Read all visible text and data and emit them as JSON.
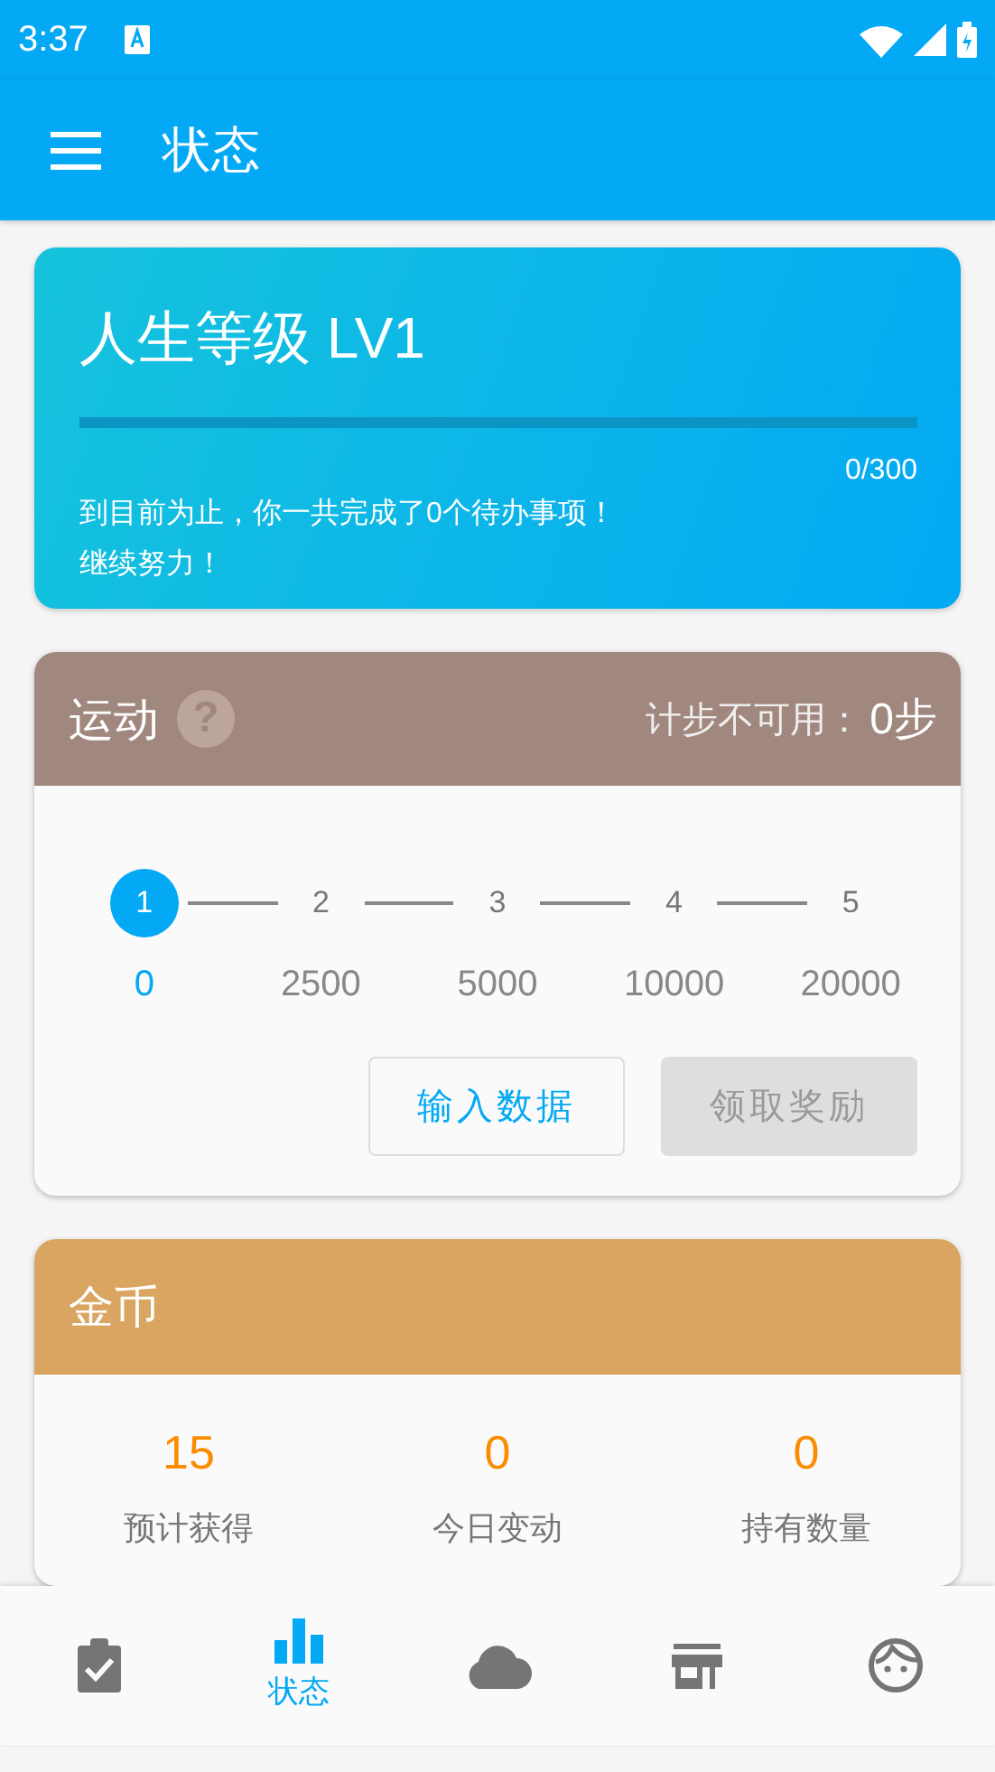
{
  "status_bar": {
    "time": "3:37"
  },
  "app_bar": {
    "title": "状态"
  },
  "level_card": {
    "title": "人生等级 LV1",
    "level": 0,
    "progress": "0/300",
    "message": "到目前为止，你一共完成了0个待办事项！",
    "encouragement": "继续努力！"
  },
  "exercise_card": {
    "title": "运动",
    "help": "?",
    "step_status_label": "计步不可用：",
    "step_count": "0步",
    "steps": [
      {
        "number": "1",
        "target": "0",
        "selected": true
      },
      {
        "number": "2",
        "target": "2500",
        "selected": false
      },
      {
        "number": "3",
        "target": "5000",
        "selected": false
      },
      {
        "number": "4",
        "target": "10000",
        "selected": false
      },
      {
        "number": "5",
        "target": "20000",
        "selected": false
      }
    ],
    "buttons": [
      {
        "label": "输入数据",
        "disabled": false
      },
      {
        "label": "领取奖励",
        "disabled": true
      }
    ]
  },
  "coin_card": {
    "title": "金币",
    "stats": [
      {
        "value": "15",
        "label": "预计获得"
      },
      {
        "value": "0",
        "label": "今日变动"
      },
      {
        "value": "0",
        "label": "持有数量"
      }
    ]
  },
  "bottom_nav": [
    {
      "kind": "tasks",
      "selected": false
    },
    {
      "kind": "status",
      "label": "状态",
      "selected": true
    },
    {
      "kind": "cloud",
      "selected": false
    },
    {
      "kind": "store",
      "selected": false
    },
    {
      "kind": "profile",
      "selected": false
    }
  ]
}
